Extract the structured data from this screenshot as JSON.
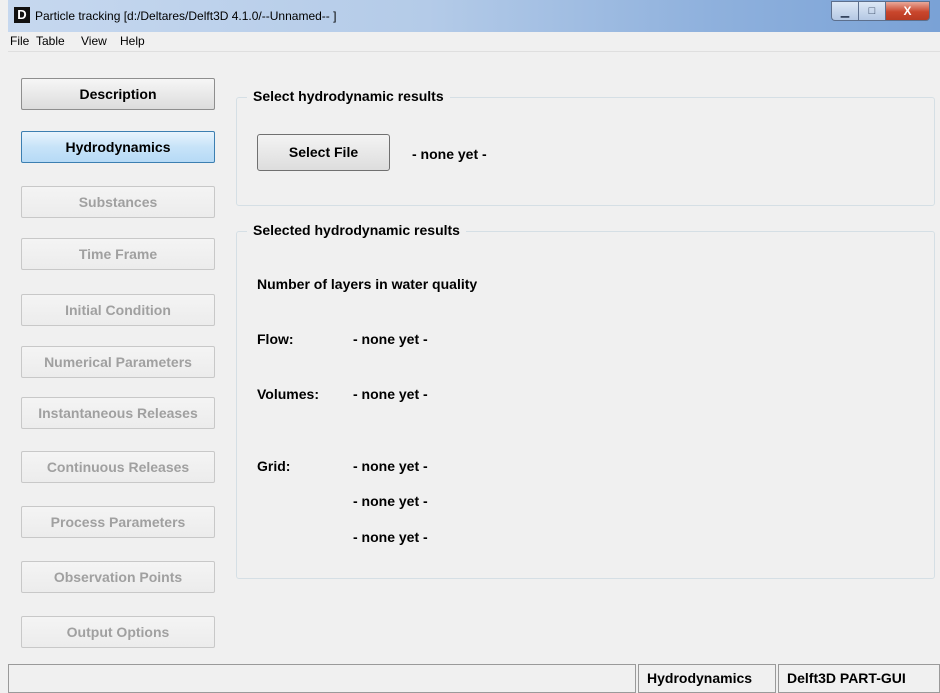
{
  "window": {
    "icon_letter": "D",
    "title": "Particle tracking  [d:/Deltares/Delft3D 4.1.0/--Unnamed-- ]",
    "controls": {
      "min": "▁",
      "max": "□",
      "close": "X"
    }
  },
  "menu": [
    "File",
    "Table",
    "View",
    "Help"
  ],
  "nav": [
    {
      "label": "Description",
      "state": "normal"
    },
    {
      "label": "Hydrodynamics",
      "state": "active"
    },
    {
      "label": "Substances",
      "state": "disabled"
    },
    {
      "label": "Time Frame",
      "state": "disabled"
    },
    {
      "label": "Initial Condition",
      "state": "disabled"
    },
    {
      "label": "Numerical Parameters",
      "state": "disabled"
    },
    {
      "label": "Instantaneous Releases",
      "state": "disabled"
    },
    {
      "label": "Continuous Releases",
      "state": "disabled"
    },
    {
      "label": "Process Parameters",
      "state": "disabled"
    },
    {
      "label": "Observation Points",
      "state": "disabled"
    },
    {
      "label": "Output Options",
      "state": "disabled"
    }
  ],
  "select_group": {
    "title": "Select hydrodynamic results",
    "button": "Select File",
    "file_value": "- none yet -"
  },
  "selected_group": {
    "title": "Selected hydrodynamic results",
    "layers_label": "Number of layers in water quality",
    "flow_label": "Flow:",
    "flow_value": "- none yet -",
    "volumes_label": "Volumes:",
    "volumes_value": "- none yet -",
    "grid_label": "Grid:",
    "grid_values": [
      "- none yet -",
      "- none yet -",
      "- none yet -"
    ]
  },
  "status": {
    "module": "Hydrodynamics",
    "app": "Delft3D PART-GUI"
  },
  "colors": {
    "active_button": "#c7e3f8",
    "window_background": "#f0f0f0",
    "disabled_text": "#a0a0a0"
  }
}
